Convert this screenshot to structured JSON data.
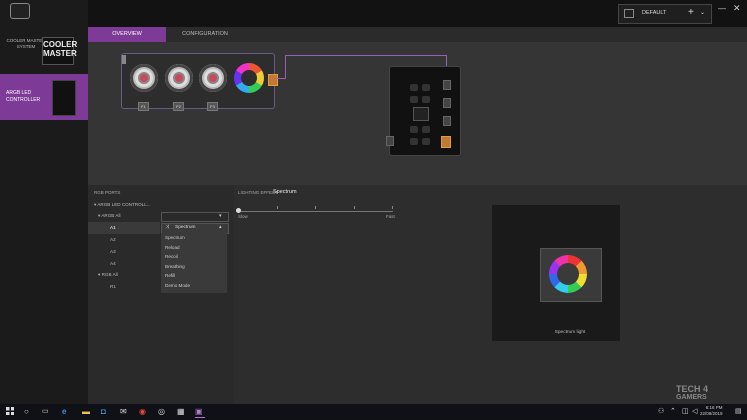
{
  "sidebar": {
    "brand_name_line1": "COOLER MASTER",
    "brand_name_line2": "SYSTEM",
    "brand_logo_line1": "COOLER",
    "brand_logo_line2": "MASTER",
    "device_label_line1": "ARGB LED",
    "device_label_line2": "CONTROLLER"
  },
  "header": {
    "profile": "DEFAULT",
    "add_glyph": "+",
    "menu_glyph": "⌄",
    "minimize_glyph": "—",
    "close_glyph": "✕"
  },
  "tabs": [
    {
      "label": "OVERVIEW"
    },
    {
      "label": "CONFIGURATION"
    }
  ],
  "overview": {
    "fan_badges": [
      "F1",
      "F2",
      "F3"
    ]
  },
  "ports_panel": {
    "title": "RGB PORTS",
    "tree": {
      "root": "ARGB LED CONTROLL...",
      "argb_group": "ARGB All",
      "argb_items": [
        "A1",
        "A2",
        "A3",
        "A4"
      ],
      "rgb_group": "RGB All",
      "rgb_items": [
        "R1"
      ]
    }
  },
  "effect_panel": {
    "label": "LIGHTING EFFECT",
    "value": "Spectrum",
    "dropdown_value": "Spectrum",
    "options": [
      "Spectrum",
      "Reload",
      "Recoil",
      "Breathing",
      "Refill",
      "Demo Mode"
    ],
    "speed_slow": "Slow",
    "speed_fast": "Fast",
    "preview_caption": "Spectrum light"
  },
  "taskbar": {
    "time": "6:16 PM",
    "date": "22/08/2019"
  },
  "watermark": {
    "line1": "TECH 4",
    "line2": "GAMERS"
  },
  "colors": {
    "accent": "#7d3a96",
    "port": "#c17a34"
  }
}
